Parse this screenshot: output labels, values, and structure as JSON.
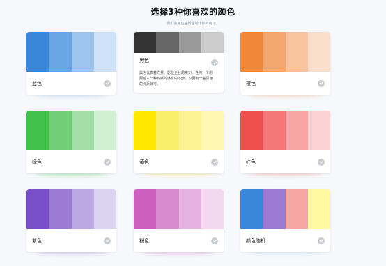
{
  "header": {
    "title": "选择3种你喜欢的颜色",
    "subtitle": "我们会用这些颜色制作你的商标。"
  },
  "icons": {
    "selected_check": "check-icon"
  },
  "cards": [
    {
      "label": "蓝色",
      "colors": [
        "#3a86d9",
        "#6aa6e3",
        "#9dc4ed",
        "#cfe1f6"
      ],
      "glow": "#bcd6f3"
    },
    {
      "label": "黑色",
      "colors": [
        "#333333",
        "#666666",
        "#999999",
        "#cccccc"
      ],
      "description": "黑色代表着力量、影显企业的实力。任何一个想要给人一种权威的感觉的logo，只要有一些黑色的元素就可。"
    },
    {
      "label": "橙色",
      "colors": [
        "#f0883a",
        "#f4a76e",
        "#f8c39f",
        "#fbdfcd"
      ],
      "glow": "#f9cfae"
    },
    {
      "label": "绿色",
      "colors": [
        "#41c04a",
        "#72cf78",
        "#a3dfa6",
        "#d1efd3"
      ],
      "glow": "#8fe39a"
    },
    {
      "label": "黄色",
      "colors": [
        "#ffe700",
        "#faee6a",
        "#fcf294",
        "#fff8b2"
      ],
      "glow": "#fbee8f"
    },
    {
      "label": "红色",
      "colors": [
        "#ef4e4f",
        "#f37877",
        "#f7a5a5",
        "#fbd1d1"
      ],
      "glow": "#f9b6b9"
    },
    {
      "label": "紫色",
      "colors": [
        "#7a4ec6",
        "#9b7bd4",
        "#bba7e2",
        "#dcd3f1"
      ],
      "glow": "#cdbfee"
    },
    {
      "label": "粉色",
      "colors": [
        "#cc5fc0",
        "#d98bd0",
        "#e6b3e0",
        "#f3d8ef"
      ],
      "glow": "#e8b6e2"
    },
    {
      "label": "颜色随机",
      "colors": [
        "#3a86d9",
        "#9b7bd4",
        "#f7a5a5",
        "#fff8a0"
      ],
      "glow": "#cfe5f6"
    }
  ]
}
